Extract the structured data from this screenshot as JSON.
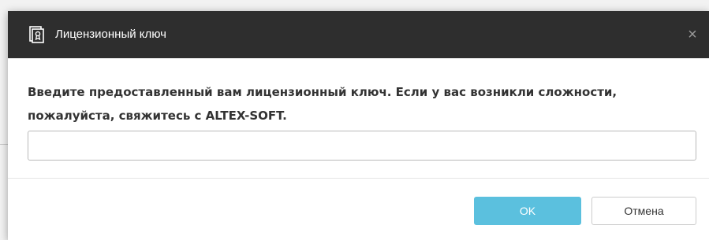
{
  "dialog": {
    "title": "Лицензионный ключ",
    "title_icon": "license-certificate-icon",
    "close_glyph": "×",
    "message": "Введите предоставленный вам лицензионный ключ. Если у вас возникли сложности, пожалуйста, свяжитесь с ALTEX-SOFT.",
    "input_value": "",
    "input_placeholder": "",
    "ok_label": "OK",
    "cancel_label": "Отмена"
  },
  "colors": {
    "titlebar": "#2e2e2e",
    "ok_button": "#5bc0de",
    "text": "#333333"
  }
}
